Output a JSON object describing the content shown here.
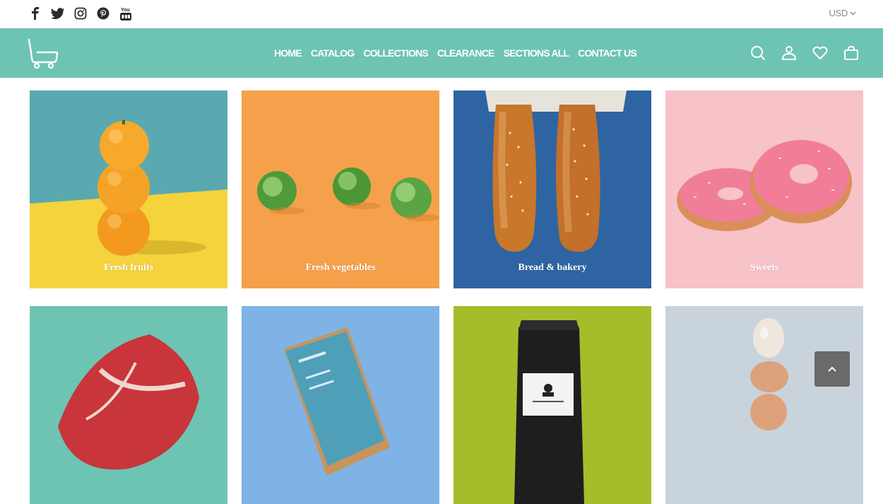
{
  "top_bar": {
    "social": [
      "facebook-icon",
      "twitter-icon",
      "instagram-icon",
      "pinterest-icon",
      "youtube-icon"
    ],
    "currency": "USD"
  },
  "nav": {
    "items": [
      "HOME",
      "CATALOG",
      "COLLECTIONS",
      "CLEARANCE",
      "SECTIONS ALL",
      "CONTACT US"
    ],
    "icons": [
      "search-icon",
      "account-icon",
      "wishlist-icon",
      "cart-icon"
    ]
  },
  "categories": [
    {
      "label": "Fresh fruits"
    },
    {
      "label": "Fresh vegetables"
    },
    {
      "label": "Bread & bakery"
    },
    {
      "label": "Sweets"
    },
    {
      "label": ""
    },
    {
      "label": ""
    },
    {
      "label": ""
    },
    {
      "label": ""
    }
  ],
  "colors": {
    "accent": "#6dc4b3",
    "scroll_button": "#6a6a6a"
  }
}
